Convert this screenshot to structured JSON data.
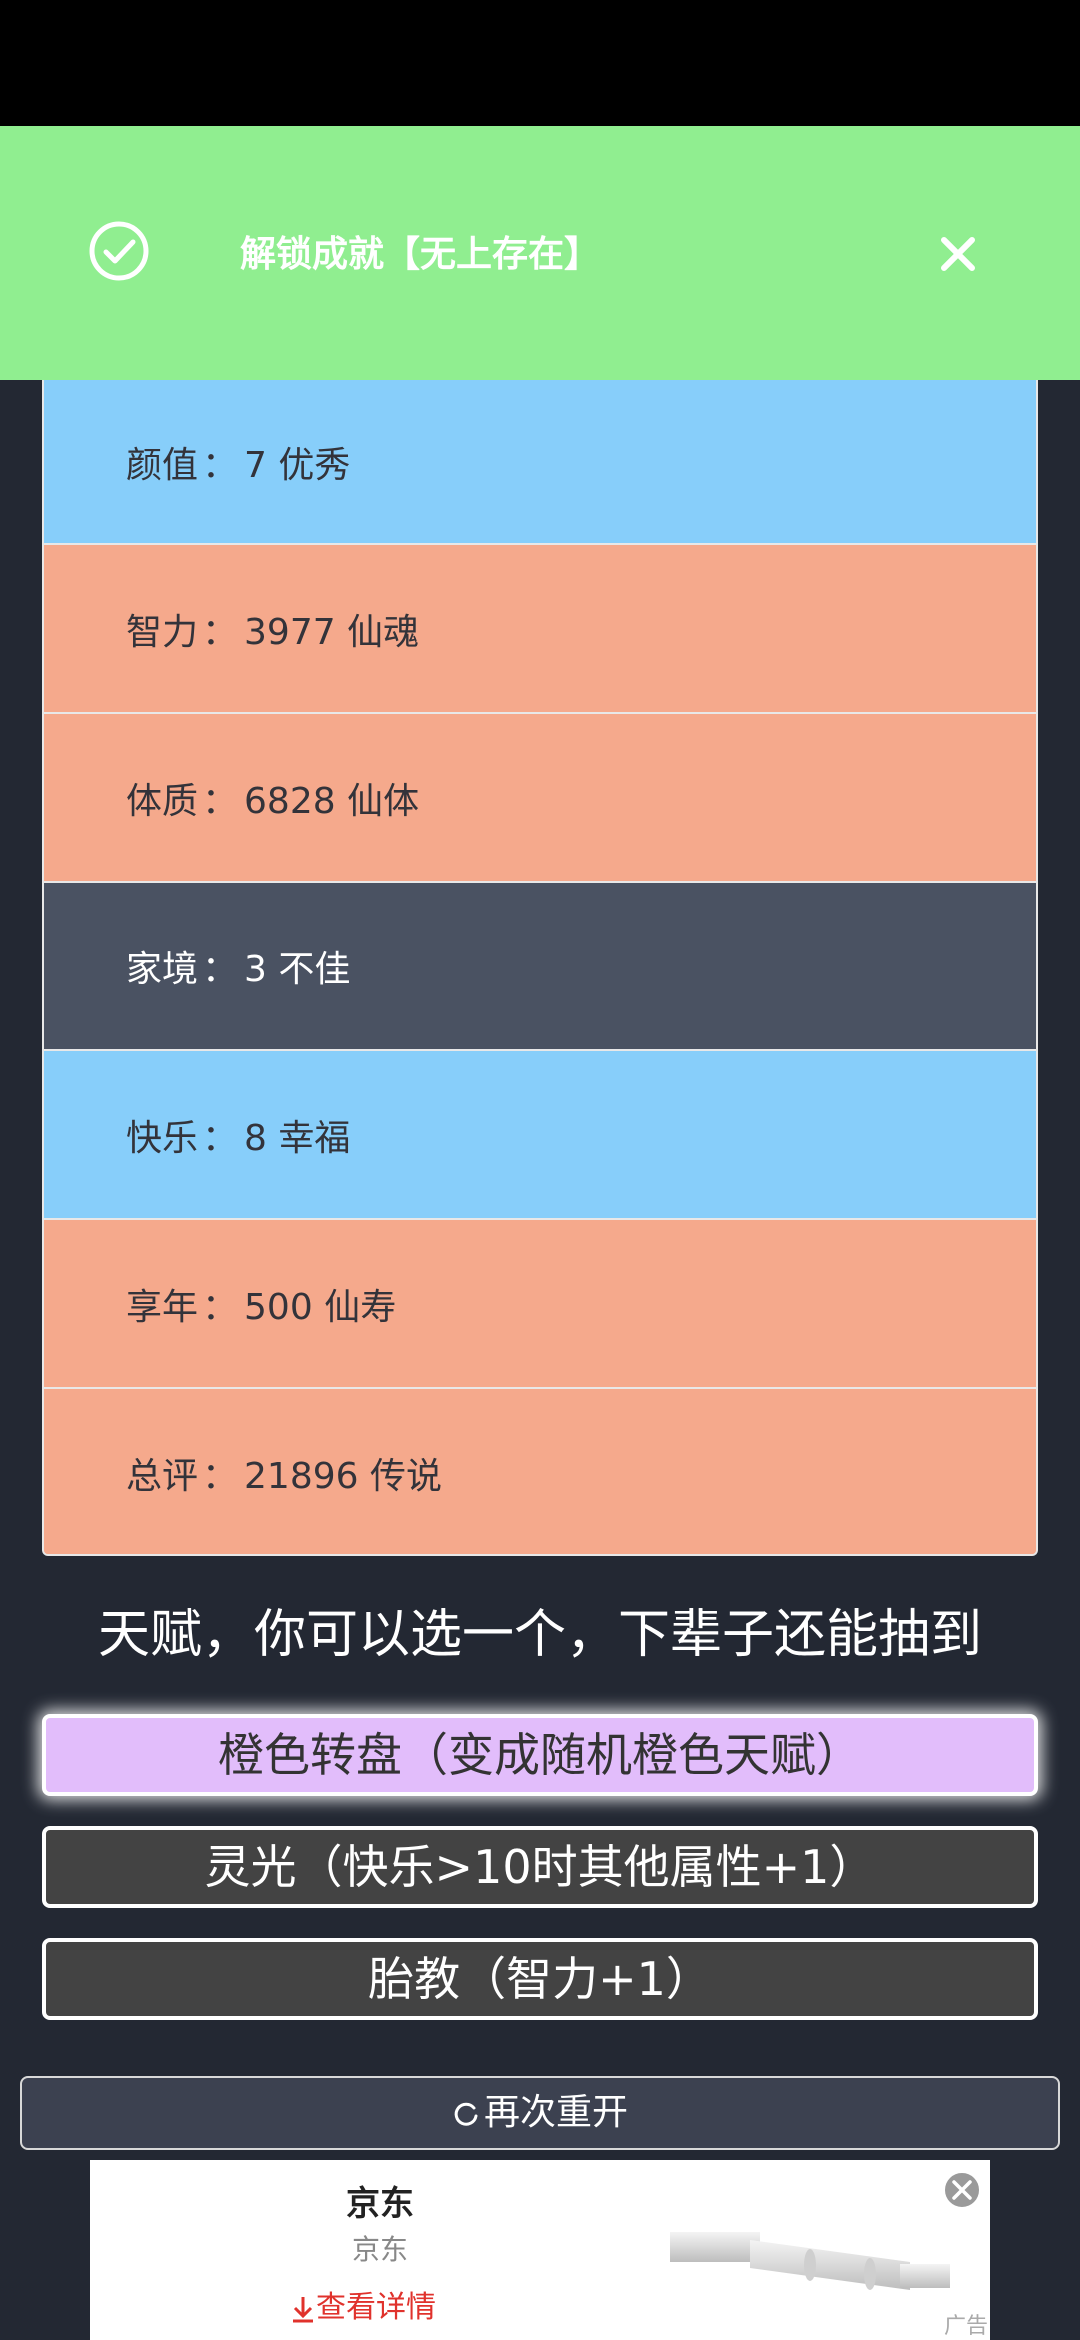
{
  "toast": {
    "text": "解锁成就【无上存在】",
    "check_icon": "check-circle-icon",
    "close_icon": "close-icon"
  },
  "stats": [
    {
      "label": "颜值",
      "sep": "：",
      "value": "7 优秀",
      "color": "blue"
    },
    {
      "label": "智力",
      "sep": "：",
      "value": "3977 仙魂",
      "color": "orange"
    },
    {
      "label": "体质",
      "sep": "：",
      "value": "6828 仙体",
      "color": "orange"
    },
    {
      "label": "家境",
      "sep": "：",
      "value": "3 不佳",
      "color": "dark"
    },
    {
      "label": "快乐",
      "sep": "：",
      "value": "8 幸福",
      "color": "blue"
    },
    {
      "label": "享年",
      "sep": "：",
      "value": "500 仙寿",
      "color": "orange"
    },
    {
      "label": "总评",
      "sep": "：",
      "value": "21896 传说",
      "color": "orange"
    }
  ],
  "talent_title": "天赋，你可以选一个，下辈子还能抽到",
  "talents": [
    {
      "label": "橙色转盘（变成随机橙色天赋）",
      "selected": true
    },
    {
      "label": "灵光（快乐>10时其他属性+1）",
      "selected": false
    },
    {
      "label": "胎教（智力+1）",
      "selected": false
    }
  ],
  "restart": {
    "icon": "refresh-icon",
    "label": "再次重开"
  },
  "ad": {
    "title": "京东",
    "subtitle": "京东",
    "link_icon": "download-arrow-icon",
    "link": "查看详情",
    "tag": "广告",
    "close_icon": "close-circle-icon"
  },
  "colors": {
    "background": "#232833",
    "toast": "#90ee90",
    "blue_row": "#87cefa",
    "orange_row": "#f5a98c",
    "dark_row": "#4a5262",
    "selected_talent": "#e2bdfb",
    "talent_bg": "#434343"
  }
}
